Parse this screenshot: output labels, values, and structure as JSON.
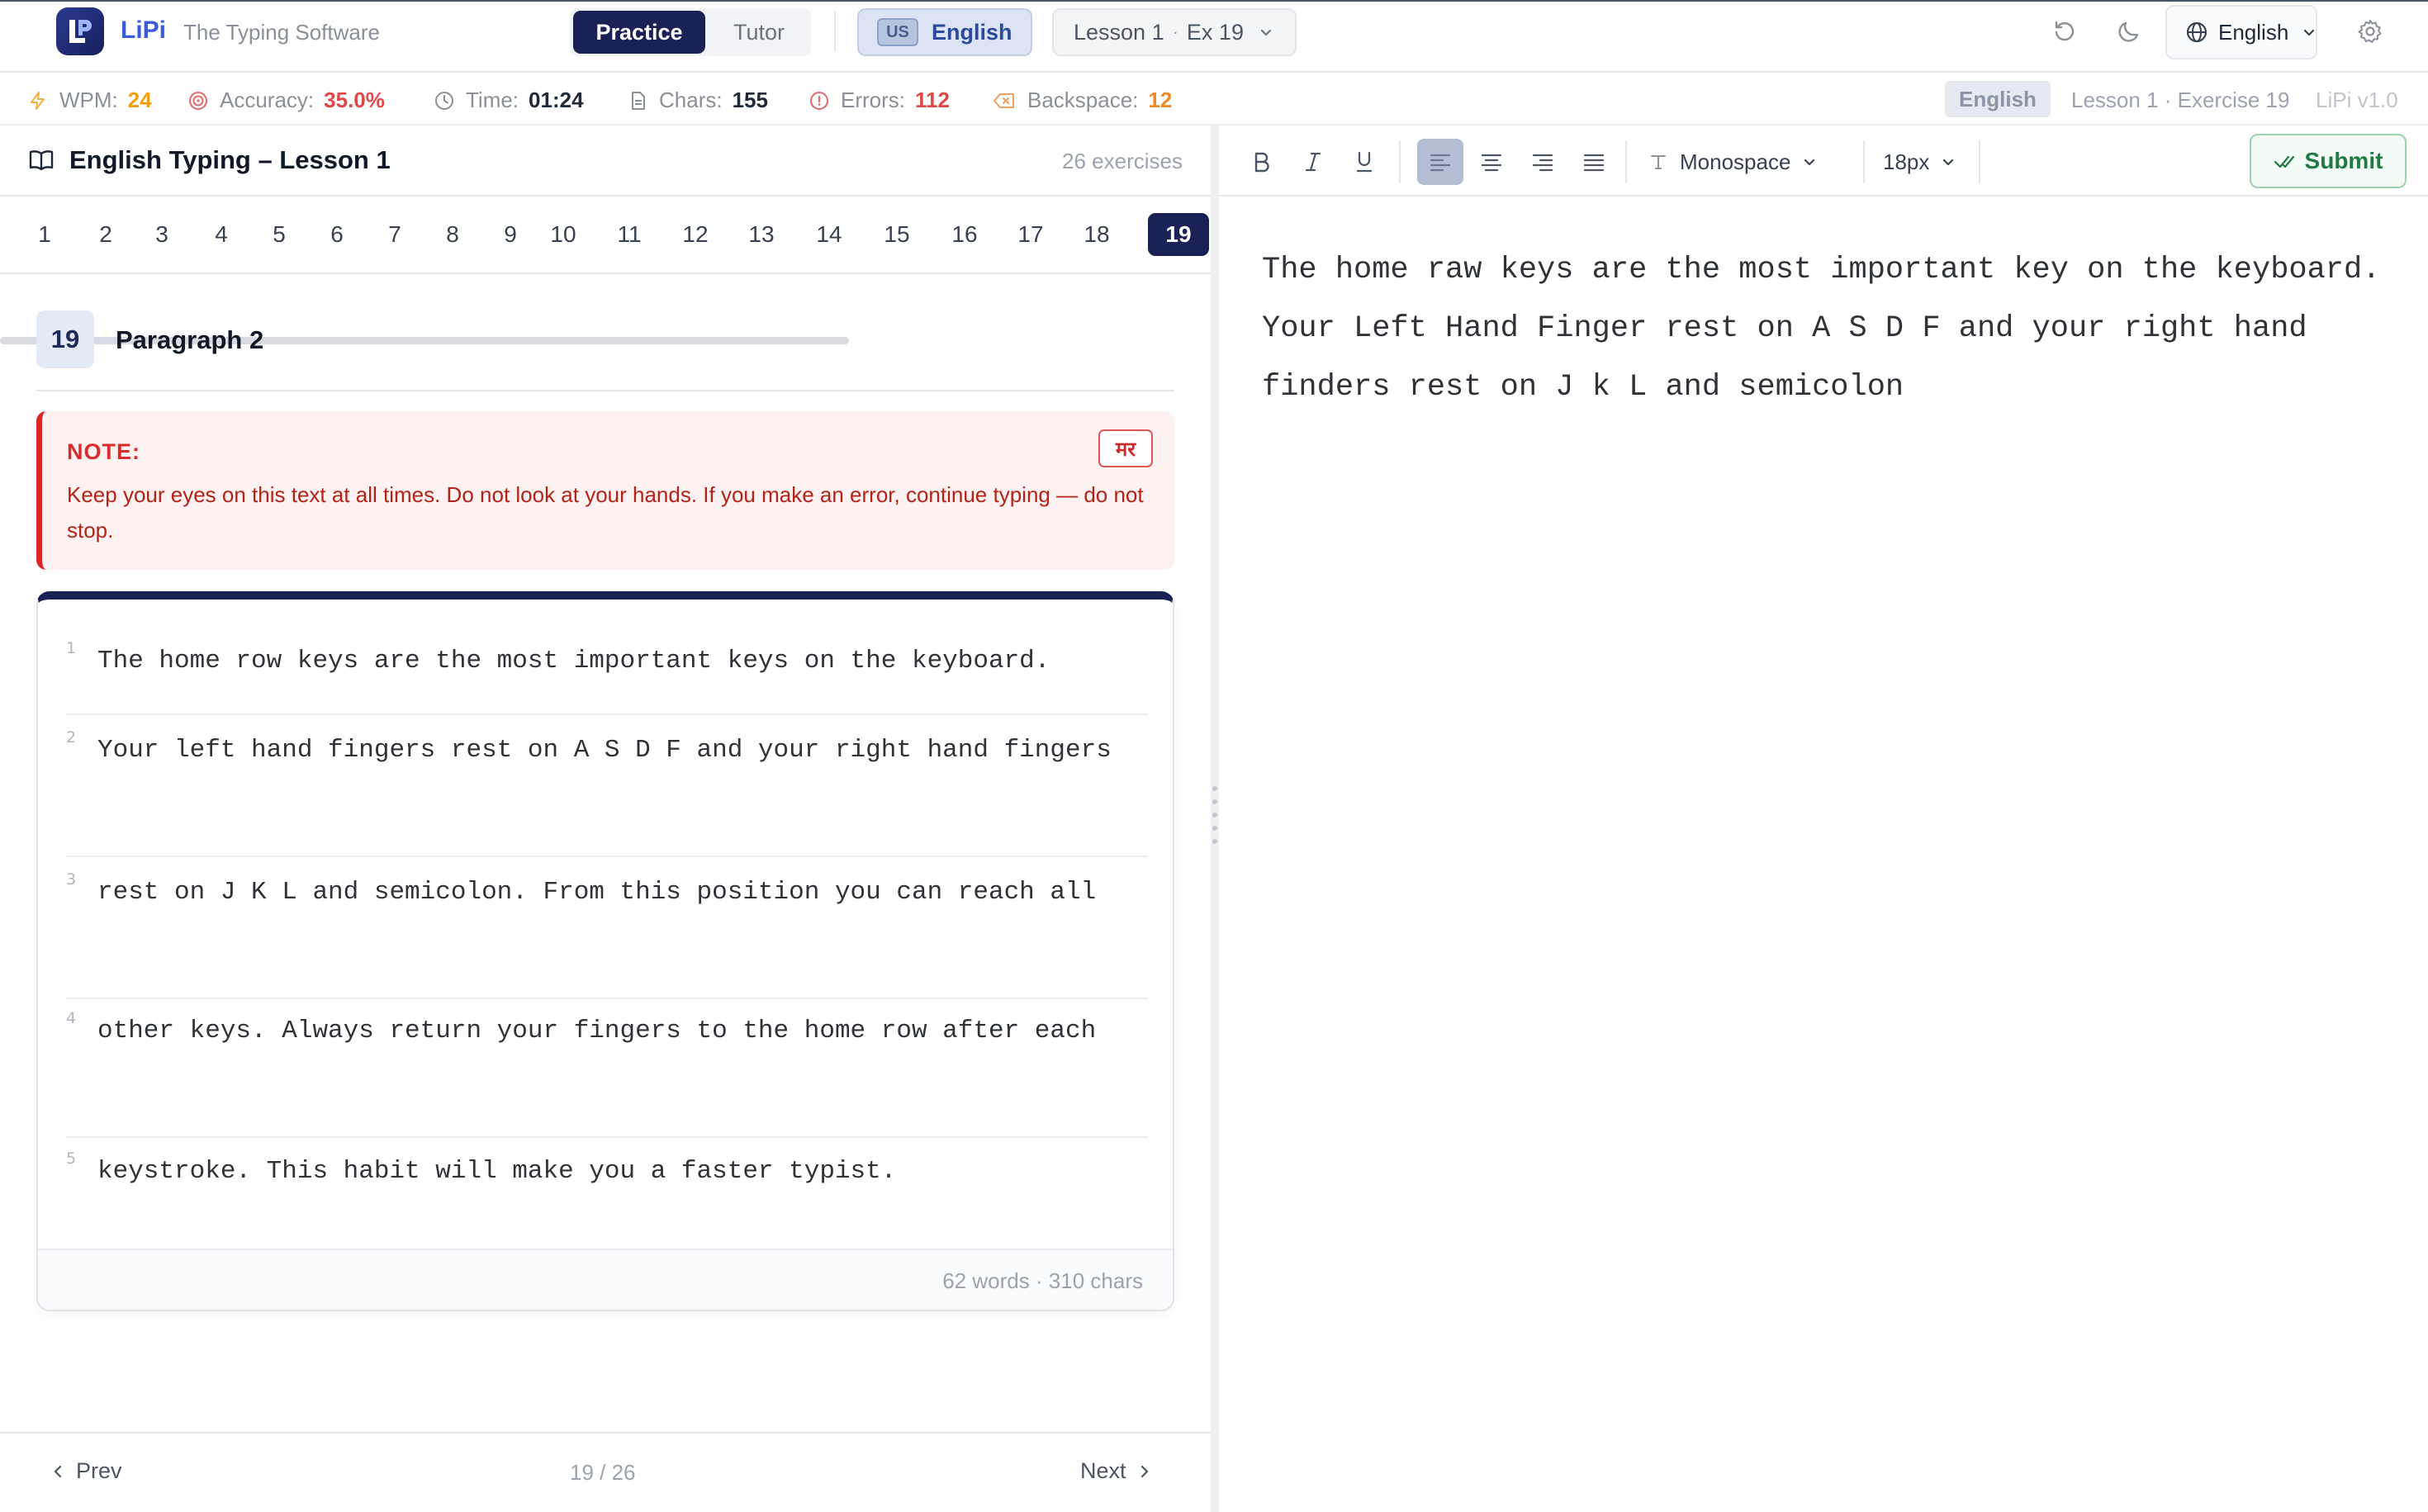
{
  "brand": {
    "name": "LiPi",
    "tagline": "The Typing Software"
  },
  "mode": {
    "practice": "Practice",
    "tutor": "Tutor"
  },
  "language_pill": {
    "flag": "US",
    "label": "English"
  },
  "lesson_selector": {
    "lesson": "Lesson 1",
    "separator": "·",
    "exercise": "Ex 19"
  },
  "ui_language": "English",
  "stats": {
    "wpm_label": "WPM:",
    "wpm": "24",
    "accuracy_label": "Accuracy:",
    "accuracy": "35.0%",
    "time_label": "Time:",
    "time": "01:24",
    "chars_label": "Chars:",
    "chars": "155",
    "errors_label": "Errors:",
    "errors": "112",
    "backspace_label": "Backspace:",
    "backspace": "12",
    "language_badge": "English",
    "location": "Lesson 1 · Exercise 19",
    "version": "LiPi v1.0"
  },
  "colors": {
    "brand": "#1a2155",
    "accent": "#3b5bdb",
    "warn": "#f59e0b",
    "error": "#dc2626",
    "success": "#1f7a43"
  },
  "lesson": {
    "title": "English Typing – Lesson 1",
    "count": "26 exercises"
  },
  "exercise_tabs": [
    "1",
    "2",
    "3",
    "4",
    "5",
    "6",
    "7",
    "8",
    "9",
    "10",
    "11",
    "12",
    "13",
    "14",
    "15",
    "16",
    "17",
    "18",
    "19"
  ],
  "active_tab": "19",
  "exercise": {
    "number": "19",
    "title": "Paragraph 2"
  },
  "note": {
    "label": "NOTE:",
    "text": "Keep your eyes on this text at all times. Do not look at your hands. If you make an error, continue typing — do not stop.",
    "script_toggle": "मर"
  },
  "passage": {
    "lines": [
      {
        "n": "1",
        "text": "The home row keys are the most important keys on the keyboard."
      },
      {
        "n": "2",
        "text": "Your left hand fingers rest on A S D F and your right hand fingers"
      },
      {
        "n": "3",
        "text": "rest on J K L and semicolon. From this position you can reach all"
      },
      {
        "n": "4",
        "text": "other keys. Always return your fingers to the home row after each"
      },
      {
        "n": "5",
        "text": "keystroke. This habit will make you a faster typist."
      }
    ],
    "footer": "62 words · 310 chars"
  },
  "navigation": {
    "prev": "Prev",
    "next": "Next",
    "position": "19 / 26"
  },
  "editor": {
    "font": "Monospace",
    "size": "18px",
    "submit": "Submit",
    "align": "left",
    "typed_text": "The home raw keys are the most important key on the keyboard.\nYour Left Hand Finger rest on A S D F and your right hand finders rest on J k L and semicolon"
  },
  "icons": [
    "lipi-logo-icon",
    "chevron-down-icon",
    "reset-icon",
    "moon-icon",
    "globe-icon",
    "gear-icon",
    "bolt-icon",
    "target-icon",
    "clock-icon",
    "document-icon",
    "alert-icon",
    "backspace-icon",
    "book-icon",
    "chevron-left-icon",
    "chevron-right-icon",
    "check-icon",
    "type-icon"
  ]
}
